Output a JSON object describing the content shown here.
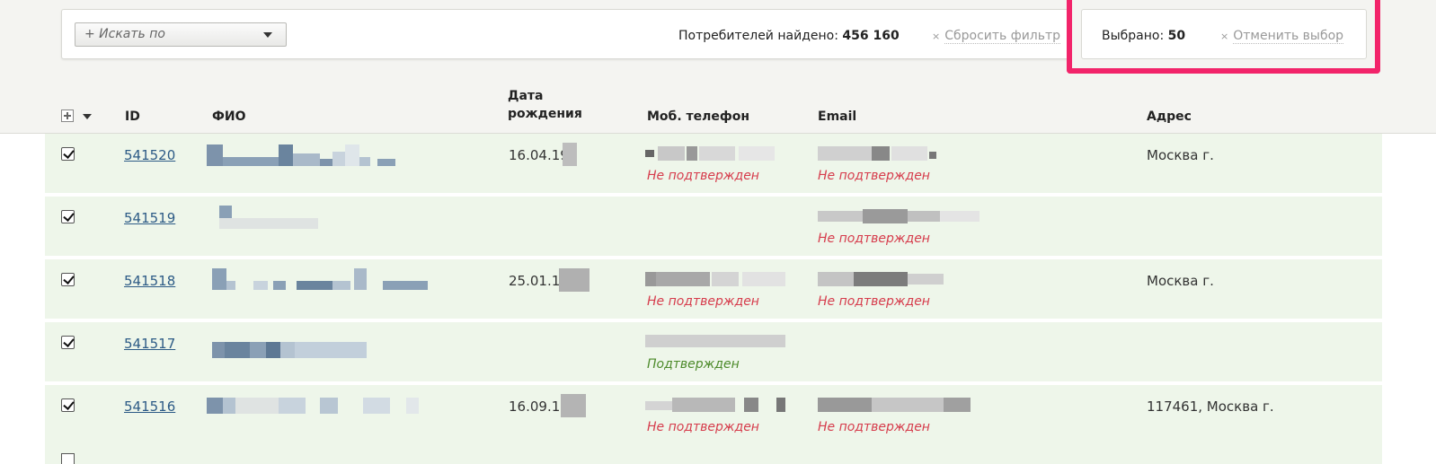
{
  "filter": {
    "search_placeholder": "+ Искать по",
    "found_label": "Потребителей найдено:",
    "found_count": "456 160",
    "reset_label": "Сбросить фильтр",
    "close_glyph": "×"
  },
  "selection": {
    "label": "Выбрано:",
    "count": "50",
    "cancel_label": "Отменить выбор"
  },
  "table": {
    "columns": {
      "id": "ID",
      "name": "ФИО",
      "dob_line1": "Дата",
      "dob_line2": "рождения",
      "phone": "Моб. телефон",
      "email": "Email",
      "address": "Адрес"
    },
    "rows": [
      {
        "id": "541520",
        "dob": "16.04.19",
        "phone_status": "Не подтвержден",
        "email_status": "Не подтвержден",
        "address": "Москва г."
      },
      {
        "id": "541519",
        "dob": "",
        "phone_status": "",
        "email_status": "Не подтвержден",
        "address": ""
      },
      {
        "id": "541518",
        "dob": "25.01.1",
        "phone_status": "Не подтвержден",
        "email_status": "Не подтвержден",
        "address": "Москва г."
      },
      {
        "id": "541517",
        "dob": "",
        "phone_status": "Подтвержден",
        "email_status": "",
        "address": ""
      },
      {
        "id": "541516",
        "dob": "16.09.1",
        "phone_status": "Не подтвержден",
        "email_status": "Не подтвержден",
        "address": "117461, Москва г."
      }
    ]
  },
  "colors": {
    "highlight": "#f2246a",
    "row_bg": "#eef6ea",
    "link": "#2d5b86",
    "unconfirmed": "#d63c4c",
    "confirmed": "#4c8a2a"
  }
}
